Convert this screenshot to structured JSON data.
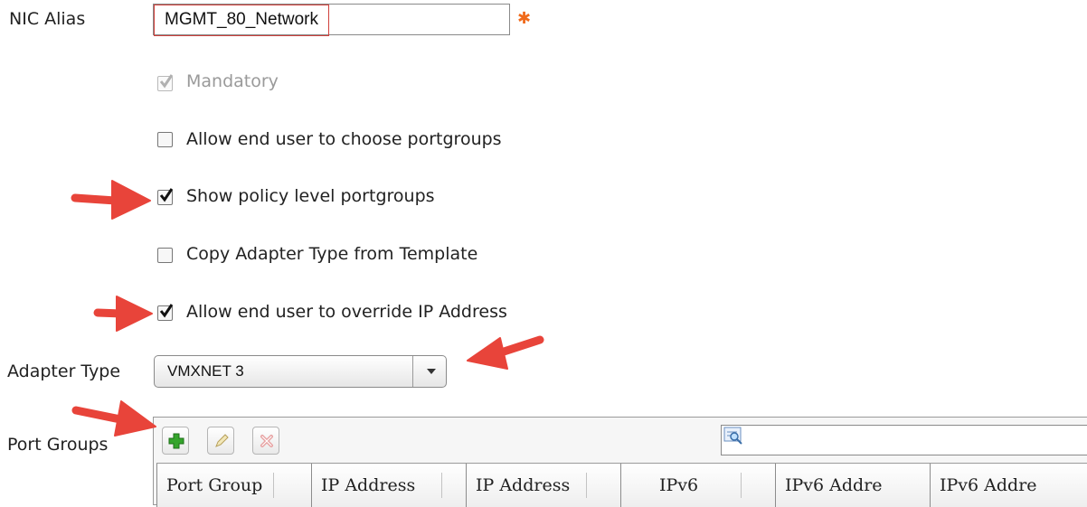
{
  "nic": {
    "label": "NIC Alias",
    "value": "MGMT_80_Network",
    "required_marker": "✱"
  },
  "checkboxes": [
    {
      "label": "Mandatory",
      "checked": true,
      "disabled": true
    },
    {
      "label": "Allow end user to choose portgroups",
      "checked": false,
      "disabled": false
    },
    {
      "label": "Show policy level portgroups",
      "checked": true,
      "disabled": false
    },
    {
      "label": "Copy Adapter Type from Template",
      "checked": false,
      "disabled": false
    },
    {
      "label": "Allow end user to override IP Address",
      "checked": true,
      "disabled": false
    }
  ],
  "adapter": {
    "label": "Adapter Type",
    "value": "VMXNET 3"
  },
  "port_groups": {
    "label": "Port Groups",
    "toolbar": [
      "add-icon",
      "edit-icon",
      "delete-icon"
    ],
    "search_value": "",
    "columns": [
      "Port Group",
      "IP Address",
      "IP Address",
      "IPv6",
      "IPv6 Addre",
      "IPv6 Addre"
    ]
  },
  "colors": {
    "required": "#f06a1b",
    "arrow": "#e8443a",
    "highlight_border": "#d0403b"
  }
}
